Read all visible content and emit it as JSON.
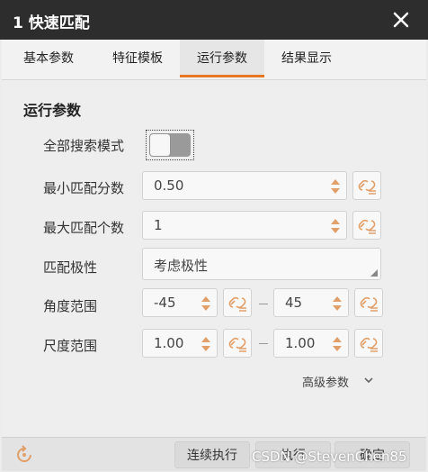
{
  "window": {
    "title": "1 快速匹配"
  },
  "tabs": [
    {
      "label": "基本参数",
      "active": false
    },
    {
      "label": "特征模板",
      "active": false
    },
    {
      "label": "运行参数",
      "active": true
    },
    {
      "label": "结果显示",
      "active": false
    }
  ],
  "section": {
    "title": "运行参数"
  },
  "params": {
    "search_mode": {
      "label": "全部搜索模式",
      "on": false
    },
    "min_score": {
      "label": "最小匹配分数",
      "value": "0.50"
    },
    "max_count": {
      "label": "最大匹配个数",
      "value": "1"
    },
    "polarity": {
      "label": "匹配极性",
      "value": "考虑极性"
    },
    "angle": {
      "label": "角度范围",
      "min": "-45",
      "max": "45"
    },
    "scale": {
      "label": "尺度范围",
      "min": "1.00",
      "max": "1.00"
    }
  },
  "advanced": {
    "label": "高级参数"
  },
  "footer": {
    "continuous_label": "连续执行",
    "execute_label": "执行",
    "confirm_label": "确定"
  },
  "watermark": "CSDN @StevenChen85",
  "colors": {
    "accent": "#e87722",
    "titlebar": "#2d2d2d",
    "icon": "#e1a06a"
  }
}
